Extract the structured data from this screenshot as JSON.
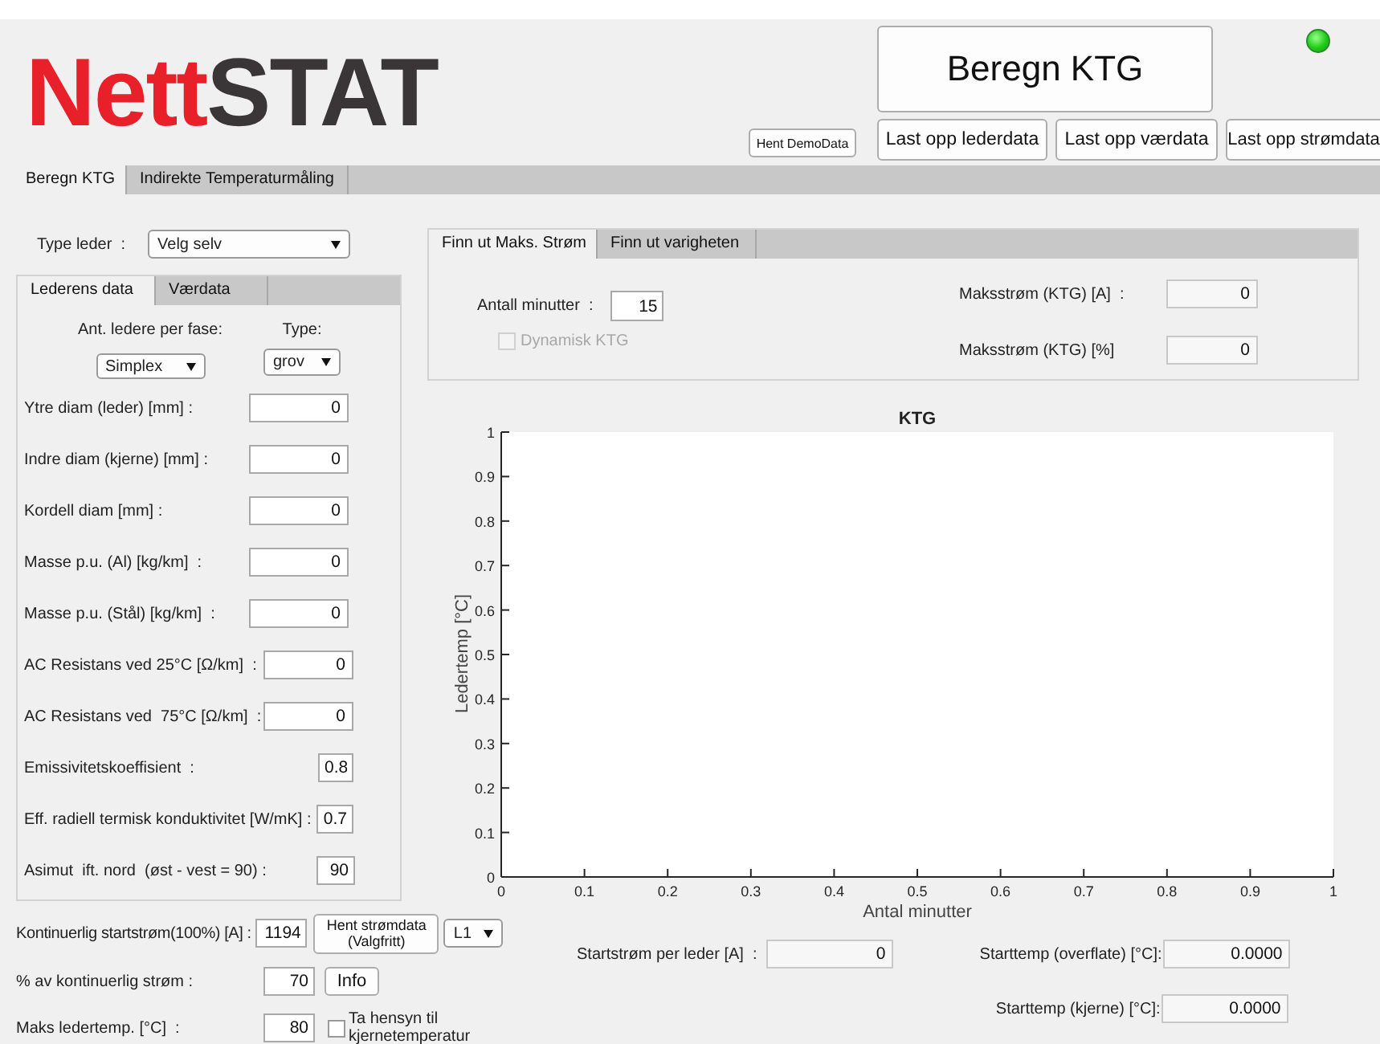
{
  "logo": {
    "prefix": "Nett",
    "suffix": "STAT"
  },
  "status_light": {
    "on": true
  },
  "demo_button": "Hent DemoData",
  "compute_button": "Beregn KTG",
  "upload_buttons": [
    "Last opp lederdata",
    "Last opp værdata",
    "Last opp strømdata"
  ],
  "main_tabs": [
    {
      "label": "Beregn KTG",
      "selected": true
    },
    {
      "label": "Indirekte Temperaturmåling",
      "selected": false
    }
  ],
  "conductor_type": {
    "label": "Type leder  :",
    "value": "Velg selv"
  },
  "data_tabs": [
    {
      "label": "Lederens data",
      "selected": true
    },
    {
      "label": "Værdata",
      "selected": false
    }
  ],
  "conductors_per_phase": {
    "label": "Ant. ledere per fase:",
    "value": "Simplex"
  },
  "surface_type": {
    "label": "Type:",
    "value": "grov"
  },
  "conductor_fields": [
    {
      "label": "Ytre diam (leder) [mm] :",
      "value": "0"
    },
    {
      "label": "Indre diam (kjerne) [mm] :",
      "value": "0"
    },
    {
      "label": "Kordell diam [mm] :",
      "value": "0"
    },
    {
      "label": "Masse p.u. (Al) [kg/km]  :",
      "value": "0"
    },
    {
      "label": "Masse p.u. (Stål) [kg/km]  :",
      "value": "0"
    },
    {
      "label": "AC Resistans ved 25°C [Ω/km]  :",
      "value": "0"
    },
    {
      "label": "AC Resistans ved  75°C [Ω/km]  :",
      "value": "0"
    },
    {
      "label": "Emissivitetskoeffisient  :",
      "value": "0.8"
    },
    {
      "label": "Eff. radiell termisk konduktivitet [W/mK] :",
      "value": "0.7"
    },
    {
      "label": "Asimut  ift. nord  (øst - vest = 90) :",
      "value": "90"
    }
  ],
  "start_current": {
    "label": "Kontinuerlig startstrøm(100%) [A] :",
    "value": "1194",
    "button": "Hent strømdata\n(Valgfritt)",
    "phase": "L1"
  },
  "percent_current": {
    "label": "% av kontinuerlig strøm :",
    "value": "70",
    "button": "Info"
  },
  "max_temp": {
    "label": "Maks ledertemp. [°C]  :",
    "value": "80",
    "option": {
      "label": "Ta hensyn til kjernetemperatur",
      "checked": false
    }
  },
  "result_tabs": [
    {
      "label": "Finn ut Maks. Strøm",
      "selected": true
    },
    {
      "label": "Finn ut varigheten",
      "selected": false
    }
  ],
  "minutes": {
    "label": "Antall minutter  :",
    "value": "15"
  },
  "dynamic_ktg": {
    "label": "Dynamisk KTG",
    "checked": false,
    "disabled": true
  },
  "max_current_a": {
    "label": "Maksstrøm (KTG) [A]  :",
    "value": "0"
  },
  "max_current_pct": {
    "label": "Maksstrøm (KTG) [%]",
    "value": "0"
  },
  "chart": {
    "chart_data": {
      "type": "line",
      "title": "KTG",
      "xlabel": "Antal minutter",
      "ylabel": "Ledertemp [°C]",
      "xlim": [
        0,
        1
      ],
      "ylim": [
        0,
        1
      ],
      "xticks": [
        0,
        0.1,
        0.2,
        0.3,
        0.4,
        0.5,
        0.6,
        0.7,
        0.8,
        0.9,
        1
      ],
      "yticks": [
        0,
        0.1,
        0.2,
        0.3,
        0.4,
        0.5,
        0.6,
        0.7,
        0.8,
        0.9,
        1
      ]
    }
  },
  "start_current_per_conductor": {
    "label": "Startstrøm per leder [A]  :",
    "value": "0"
  },
  "start_temp_surface": {
    "label": "Starttemp (overflate) [°C]:",
    "value": "0.0000"
  },
  "start_temp_core": {
    "label": "Starttemp (kjerne) [°C]:",
    "value": "0.0000"
  }
}
